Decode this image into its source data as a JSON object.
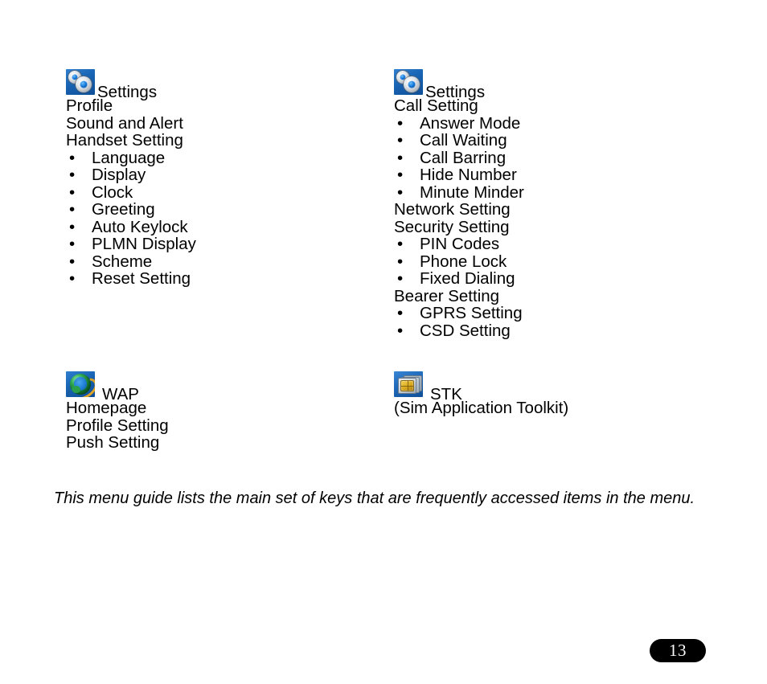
{
  "page": {
    "number": "13",
    "footnote": "This menu guide lists the main set of keys that are frequently accessed items in the menu."
  },
  "sections": [
    {
      "id": "settings-left",
      "icon": "settings-gear-icon",
      "title": "Settings",
      "lines": [
        {
          "text": "Profile",
          "level": "top"
        },
        {
          "text": "Sound and Alert",
          "level": "top"
        },
        {
          "text": "Handset Setting",
          "level": "top"
        },
        {
          "text": "Language",
          "level": "bullet"
        },
        {
          "text": "Display",
          "level": "bullet"
        },
        {
          "text": "Clock",
          "level": "bullet"
        },
        {
          "text": "Greeting",
          "level": "bullet"
        },
        {
          "text": "Auto Keylock",
          "level": "bullet"
        },
        {
          "text": "PLMN Display",
          "level": "bullet"
        },
        {
          "text": "Scheme",
          "level": "bullet"
        },
        {
          "text": "Reset Setting",
          "level": "bullet"
        }
      ]
    },
    {
      "id": "settings-right",
      "icon": "settings-gear-icon",
      "title": "Settings",
      "lines": [
        {
          "text": "Call Setting",
          "level": "top"
        },
        {
          "text": "Answer Mode",
          "level": "bullet"
        },
        {
          "text": "Call Waiting",
          "level": "bullet"
        },
        {
          "text": "Call Barring",
          "level": "bullet"
        },
        {
          "text": "Hide Number",
          "level": "bullet"
        },
        {
          "text": "Minute Minder",
          "level": "bullet"
        },
        {
          "text": "Network Setting",
          "level": "top"
        },
        {
          "text": "Security Setting",
          "level": "top"
        },
        {
          "text": "PIN Codes",
          "level": "bullet"
        },
        {
          "text": "Phone Lock",
          "level": "bullet"
        },
        {
          "text": "Fixed Dialing",
          "level": "bullet"
        },
        {
          "text": "Bearer Setting",
          "level": "top"
        },
        {
          "text": "GPRS Setting",
          "level": "bullet"
        },
        {
          "text": "CSD Setting",
          "level": "bullet"
        }
      ]
    },
    {
      "id": "wap",
      "icon": "globe-icon",
      "title": "WAP",
      "lines": [
        {
          "text": "Homepage",
          "level": "top"
        },
        {
          "text": "Profile Setting",
          "level": "top"
        },
        {
          "text": "Push Setting",
          "level": "top"
        }
      ]
    },
    {
      "id": "stk",
      "icon": "sim-card-icon",
      "title": "STK",
      "lines": [
        {
          "text": "(Sim Application Toolkit)",
          "level": "top"
        }
      ]
    }
  ],
  "bullet_glyph": "•"
}
